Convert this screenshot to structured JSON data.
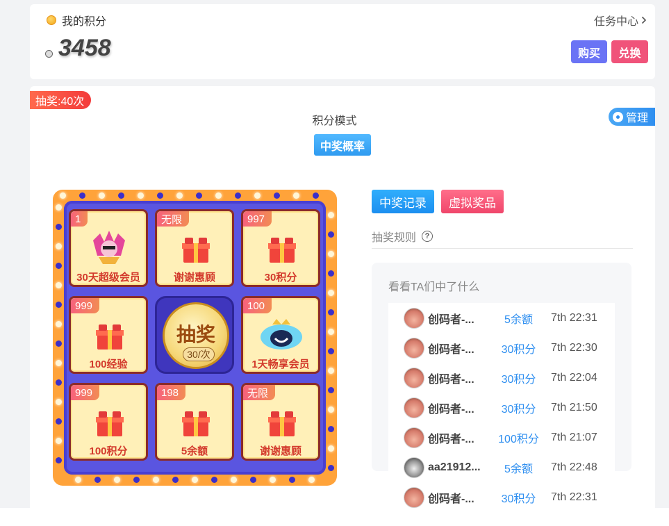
{
  "header": {
    "title": "我的积分",
    "task_center": "任务中心",
    "points": "3458",
    "buy_label": "购买",
    "exchange_label": "兑换"
  },
  "lottery": {
    "draw_badge": "抽奖:40次",
    "manage_label": "管理",
    "mode": "积分模式",
    "probability_btn": "中奖概率",
    "center_label": "抽奖",
    "center_cost": "30/次",
    "cells": [
      {
        "tag": "1",
        "name": "30天超级会员"
      },
      {
        "tag": "无限",
        "name": "谢谢惠顾"
      },
      {
        "tag": "997",
        "name": "30积分"
      },
      {
        "tag": "999",
        "name": "100经验"
      },
      {
        "tag": "100",
        "name": "1天畅享会员"
      },
      {
        "tag": "999",
        "name": "100积分"
      },
      {
        "tag": "198",
        "name": "5余额"
      },
      {
        "tag": "无限",
        "name": "谢谢惠顾"
      }
    ]
  },
  "right": {
    "record_btn": "中奖记录",
    "virtual_btn": "虚拟奖品",
    "rules": "抽奖规则",
    "winners_title": "看看TA们中了什么",
    "winners": [
      {
        "name": "创码者-...",
        "prize": "5余额",
        "time": "7th 22:31"
      },
      {
        "name": "创码者-...",
        "prize": "30积分",
        "time": "7th 22:30"
      },
      {
        "name": "创码者-...",
        "prize": "30积分",
        "time": "7th 22:04"
      },
      {
        "name": "创码者-...",
        "prize": "30积分",
        "time": "7th 21:50"
      },
      {
        "name": "创码者-...",
        "prize": "100积分",
        "time": "7th 21:07"
      },
      {
        "name": "aa21912...",
        "prize": "5余额",
        "time": "7th 22:48"
      },
      {
        "name": "创码者-...",
        "prize": "30积分",
        "time": "7th 22:31"
      }
    ]
  },
  "colors": {
    "accent_blue": "#2f8ff0",
    "buy_button": "#6a73f5",
    "exchange_button": "#f0537a",
    "board_orange": "#ffa33a",
    "board_purple": "#5a55e0"
  }
}
